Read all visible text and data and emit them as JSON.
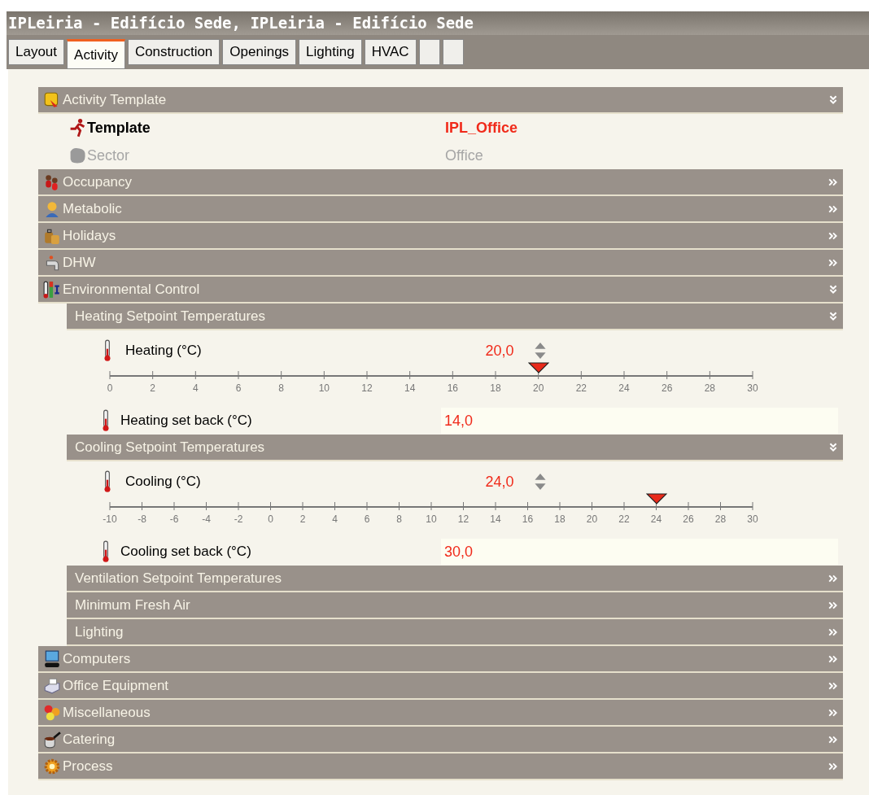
{
  "window": {
    "title": "IPLeiria - Edifício Sede, IPLeiria - Edifício Sede"
  },
  "tabs": [
    {
      "label": "Layout",
      "selected": false
    },
    {
      "label": "Activity",
      "selected": true
    },
    {
      "label": "Construction",
      "selected": false
    },
    {
      "label": "Openings",
      "selected": false
    },
    {
      "label": "Lighting",
      "selected": false
    },
    {
      "label": "HVAC",
      "selected": false
    },
    {
      "selected": false
    },
    {
      "selected": false
    }
  ],
  "sections": [
    {
      "label": "Activity Template",
      "expanded": true,
      "rows": [
        {
          "kind": "field",
          "label": "Template",
          "value": "IPL_Office",
          "disabled": false
        },
        {
          "kind": "field",
          "label": "Sector",
          "value": "Office",
          "disabled": true
        }
      ]
    },
    {
      "label": "Occupancy",
      "expanded": false
    },
    {
      "label": "Metabolic",
      "expanded": false
    },
    {
      "label": "Holidays",
      "expanded": false
    },
    {
      "label": "DHW",
      "expanded": false
    },
    {
      "label": "Environmental Control",
      "expanded": true,
      "children": [
        {
          "label": "Heating Setpoint Temperatures",
          "expanded": true,
          "rows": [
            {
              "kind": "slider",
              "label": "Heating (°C)",
              "value": "20,0",
              "level": 0.6667,
              "ticks": [
                "0",
                "2",
                "4",
                "6",
                "8",
                "10",
                "12",
                "14",
                "16",
                "18",
                "20",
                "22",
                "24",
                "26",
                "28",
                "30"
              ]
            },
            {
              "kind": "input",
              "label": "Heating set back (°C)",
              "value": "14,0"
            }
          ]
        },
        {
          "label": "Cooling Setpoint Temperatures",
          "expanded": true,
          "rows": [
            {
              "kind": "slider",
              "label": "Cooling (°C)",
              "value": "24,0",
              "level": 0.85,
              "ticks": [
                "-10",
                "-8",
                "-6",
                "-4",
                "-2",
                "0",
                "2",
                "4",
                "6",
                "8",
                "10",
                "12",
                "14",
                "16",
                "18",
                "20",
                "22",
                "24",
                "26",
                "28",
                "30"
              ]
            },
            {
              "kind": "input",
              "label": "Cooling set back (°C)",
              "value": "30,0"
            }
          ]
        },
        {
          "label": "Ventilation Setpoint Temperatures",
          "expanded": false
        },
        {
          "label": "Minimum Fresh Air",
          "expanded": false
        },
        {
          "label": "Lighting",
          "expanded": false
        }
      ]
    },
    {
      "label": "Computers",
      "expanded": false
    },
    {
      "label": "Office Equipment",
      "expanded": false
    },
    {
      "label": "Miscellaneous",
      "expanded": false
    },
    {
      "label": "Catering",
      "expanded": false
    },
    {
      "label": "Process",
      "expanded": false
    }
  ]
}
